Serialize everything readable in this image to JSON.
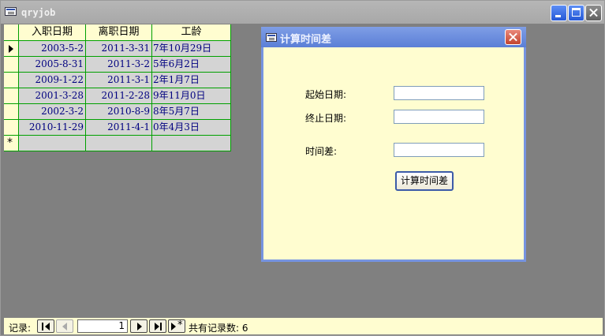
{
  "window": {
    "title": "qryjob"
  },
  "datasheet": {
    "columns": [
      "入职日期",
      "离职日期",
      "工龄"
    ],
    "rows": [
      [
        "2003-5-2",
        "2011-3-31",
        "7年10月29日"
      ],
      [
        "2005-8-31",
        "2011-3-2",
        "5年6月2日"
      ],
      [
        "2009-1-22",
        "2011-3-1",
        "2年1月7日"
      ],
      [
        "2001-3-28",
        "2011-2-28",
        "9年11月0日"
      ],
      [
        "2002-3-2",
        "2010-8-9",
        "8年5月7日"
      ],
      [
        "2010-11-29",
        "2011-4-1",
        "0年4月3日"
      ]
    ],
    "new_row_marker": "*"
  },
  "dialog": {
    "title": "计算时间差",
    "start_label": "起始日期:",
    "start_value": "",
    "end_label": "终止日期:",
    "end_value": "",
    "diff_label": "时间差:",
    "diff_value": "",
    "calc_button": "计算时间差"
  },
  "navigator": {
    "record_label": "记录:",
    "current_record": "1",
    "total_text": "共有记录数: 6"
  },
  "colors": {
    "grid_line": "#00a000",
    "cell_text": "#000080",
    "form_background": "#fffdd0"
  }
}
